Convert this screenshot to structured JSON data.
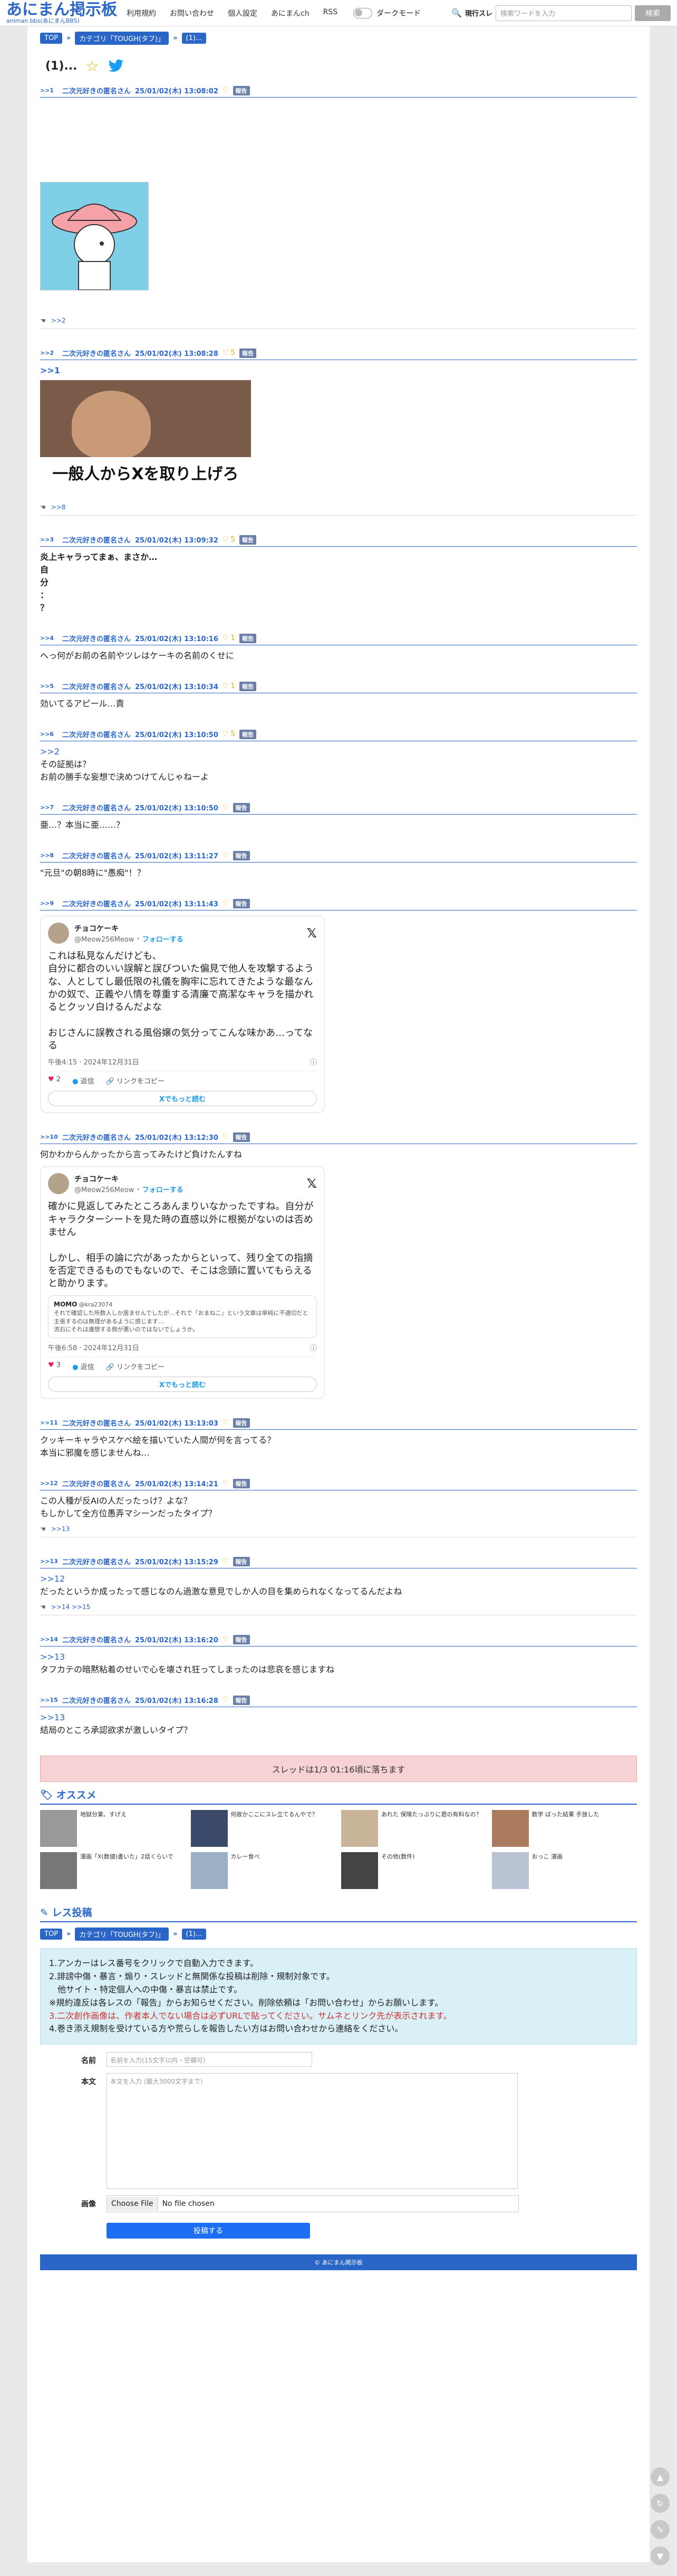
{
  "header": {
    "logo_title": "あにまん掲示板",
    "logo_sub": "animan bbs(あにまんBBS)",
    "nav": [
      "利用規約",
      "お問い合わせ",
      "個人設定",
      "あにまんch",
      "RSS"
    ],
    "dark_mode": "ダークモード",
    "search_label": "現行スレ",
    "search_placeholder": "検索ワードを入力",
    "search_button": "検索"
  },
  "breadcrumb": [
    "TOP",
    "カテゴリ「TOUGH(タフ)」",
    "(1)..."
  ],
  "thread_title": "(1)...",
  "posts": [
    {
      "num": ">>1",
      "author": "二次元好きの匿名さん",
      "date": "25/01/02(木) 13:08:02",
      "likes": "",
      "report": "報告",
      "body": [],
      "replies": ">>2"
    },
    {
      "num": ">>2",
      "author": "二次元好きの匿名さん",
      "date": "25/01/02(木) 13:08:28",
      "likes": "5",
      "report": "報告",
      "body": [
        ">>1"
      ],
      "photo_caption": "一般人からXを取り上げろ",
      "replies": ">>8"
    },
    {
      "num": ">>3",
      "author": "二次元好きの匿名さん",
      "date": "25/01/02(木) 13:09:32",
      "likes": "5",
      "report": "報告",
      "body": [
        "炎上キャラってまぁ、まさか…",
        "自",
        "分",
        "：",
        "？"
      ]
    },
    {
      "num": ">>4",
      "author": "二次元好きの匿名さん",
      "date": "25/01/02(木) 13:10:16",
      "likes": "1",
      "report": "報告",
      "body": [
        "へっ何がお前の名前やツレはケーキの名前のくせに"
      ]
    },
    {
      "num": ">>5",
      "author": "二次元好きの匿名さん",
      "date": "25/01/02(木) 13:10:34",
      "likes": "1",
      "report": "報告",
      "body": [
        "効いてるアピール…責"
      ]
    },
    {
      "num": ">>6",
      "author": "二次元好きの匿名さん",
      "date": "25/01/02(木) 13:10:50",
      "likes": "5",
      "report": "報告",
      "body": [
        ">>2",
        "その証拠は？",
        "お前の勝手な妄想で決めつけてんじゃねーよ"
      ]
    },
    {
      "num": ">>7",
      "author": "二次元好きの匿名さん",
      "date": "25/01/02(木) 13:10:50",
      "likes": "",
      "report": "報告",
      "body": [
        "亜…？本当に亜……？"
      ]
    },
    {
      "num": ">>8",
      "author": "二次元好きの匿名さん",
      "date": "25/01/02(木) 13:11:27",
      "likes": "",
      "report": "報告",
      "body": [
        "\"元旦\"の朝8時に\"愚痴\"！？"
      ]
    },
    {
      "num": ">>9",
      "author": "二次元好きの匿名さん",
      "date": "25/01/02(木) 13:11:43",
      "likes": "",
      "report": "報告",
      "body": []
    },
    {
      "num": ">>10",
      "author": "二次元好きの匿名さん",
      "date": "25/01/02(木) 13:12:30",
      "likes": "",
      "report": "報告",
      "body": [
        "何かわからんかったから言ってみたけど負けたんすね"
      ]
    },
    {
      "num": ">>11",
      "author": "二次元好きの匿名さん",
      "date": "25/01/02(木) 13:13:03",
      "likes": "",
      "report": "報告",
      "body": [
        "クッキーキャラやスケベ絵を描いていた人間が何を言ってる？",
        "本当に邪魔を感じませんね…"
      ]
    },
    {
      "num": ">>12",
      "author": "二次元好きの匿名さん",
      "date": "25/01/02(木) 13:14:21",
      "likes": "",
      "report": "報告",
      "body": [
        "この人種が反AIの人だったっけ？よな？",
        "もしかして全方位愚弄マシーンだったタイプ？"
      ],
      "replies": ">>13"
    },
    {
      "num": ">>13",
      "author": "二次元好きの匿名さん",
      "date": "25/01/02(木) 13:15:29",
      "likes": "",
      "report": "報告",
      "body": [
        ">>12",
        "だったというか成ったって感じなのん過激な意見でしか人の目を集められなくなってるんだよね"
      ],
      "replies": ">>14 >>15"
    },
    {
      "num": ">>14",
      "author": "二次元好きの匿名さん",
      "date": "25/01/02(木) 13:16:20",
      "likes": "",
      "report": "報告",
      "body": [
        ">>13",
        "タフカテの暗黙粘着のせいで心を壊され狂ってしまったのは悲哀を感じますね"
      ]
    },
    {
      "num": ">>15",
      "author": "二次元好きの匿名さん",
      "date": "25/01/02(木) 13:16:28",
      "likes": "",
      "report": "報告",
      "body": [
        ">>13",
        "結局のところ承認欲求が激しいタイプ？"
      ]
    }
  ],
  "tweet1": {
    "name": "チョコケーキ",
    "handle": "@Meow256Meow",
    "follow": "フォローする",
    "text": "これは私見なんだけども、\n自分に都合のいい誤解と誤びついた偏見で他人を攻撃するような、人としてし最低限の礼儀を胸牢に忘れてきたような最なんかの奴で、正義や八情を尊重する清廉で高潔なキャラを描かれるとクッソ白けるんだよな\n\nおじさんに誤教される風俗嬢の気分ってこんな味かあ…ってなる",
    "time": "午後4:15 · 2024年12月31日",
    "likes": "2",
    "reply": "返信",
    "copy": "リンクをコピー",
    "more": "Xでもっと読む"
  },
  "tweet2": {
    "name": "チョコケーキ",
    "handle": "@Meow256Meow",
    "follow": "フォローする",
    "text": "確かに見返してみたところあんまりいなかったですね。自分がキャラクターシートを見た時の直感以外に根拠がないのは否めません\n\nしかし、相手の論に穴があったからといって、残り全ての指摘を否定できるものでもないので、そこは念頭に置いてもらえると助かります。",
    "quote_name": "MOMO",
    "quote_handle": "@kra23074",
    "quote_text": "それで確認した所数人しか居ませんでしたが…それで「おまねこ」という文章は単純に不適切だと主張するのは無理があるように感じます…\n流石にそれは連想する側が悪いのではないでしょうか。",
    "time": "午後6:58 · 2024年12月31日",
    "likes": "3",
    "reply": "返信",
    "copy": "リンクをコピー",
    "more": "Xでもっと読む"
  },
  "notice": "スレッドは1/3 01:16頃に落ちます",
  "recommend": {
    "title": "オススメ",
    "items": [
      "地獄分業、すげえ",
      "何故かここにスレ立てるんやで？",
      "あれた 保険たっぷりに君の有料なの？",
      "数学 ばった結果 手放した",
      "漫画「X(数値)書いた」2話くらいで",
      "カレー食べ",
      "その他(数件)",
      "おっこ 漫画"
    ]
  },
  "post_form": {
    "title": "レス投稿",
    "rules": [
      "1.アンカーはレス番号をクリックで自動入力できます。",
      "2.誹謗中傷・暴言・煽り・スレッドと無関係な投稿は削除・規制対象です。",
      "他サイト・特定個人への中傷・暴言は禁止です。",
      "※規約違反は各レスの「報告」からお知らせください。削除依頼は「お問い合わせ」からお願いします。",
      "3.二次創作画像は、作者本人でない場合は必ずURLで貼ってください。サムネとリンク先が表示されます。",
      "4.巻き添え規制を受けている方や荒らしを報告したい方はお問い合わせから連絡をください。"
    ],
    "name_label": "名前",
    "name_placeholder": "名前を入力(15文字以内・空欄可)",
    "body_label": "本文",
    "body_placeholder": "本文を入力 (最大3000文字まで)",
    "image_label": "画像",
    "file_button": "Choose File",
    "file_none": "No file chosen",
    "submit": "投稿する"
  },
  "footer": "© あにまん掲示板"
}
